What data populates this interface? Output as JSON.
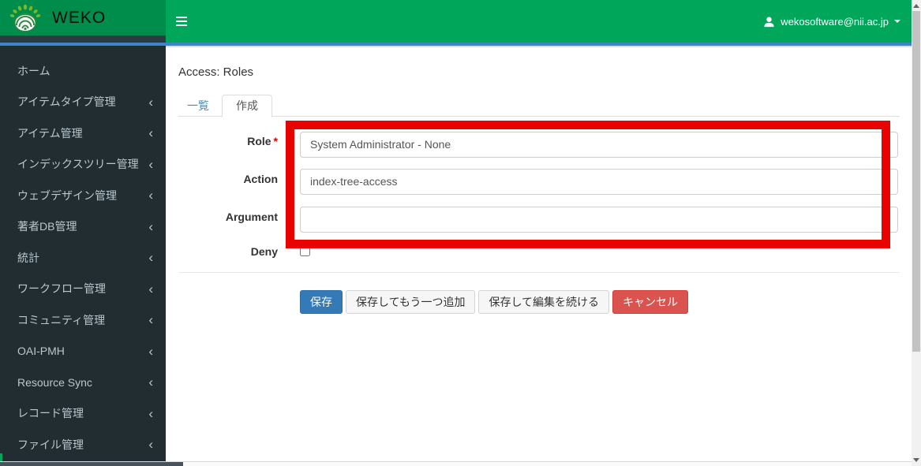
{
  "header": {
    "brand": "WEKO",
    "user_email": "wekosoftware@nii.ac.jp"
  },
  "sidebar": {
    "items": [
      {
        "label": "ホーム",
        "has_submenu": false
      },
      {
        "label": "アイテムタイプ管理",
        "has_submenu": true
      },
      {
        "label": "アイテム管理",
        "has_submenu": true
      },
      {
        "label": "インデックスツリー管理",
        "has_submenu": true
      },
      {
        "label": "ウェブデザイン管理",
        "has_submenu": true
      },
      {
        "label": "著者DB管理",
        "has_submenu": true
      },
      {
        "label": "統計",
        "has_submenu": true
      },
      {
        "label": "ワークフロー管理",
        "has_submenu": true
      },
      {
        "label": "コミュニティ管理",
        "has_submenu": true
      },
      {
        "label": "OAI-PMH",
        "has_submenu": true
      },
      {
        "label": "Resource Sync",
        "has_submenu": true
      },
      {
        "label": "レコード管理",
        "has_submenu": true
      },
      {
        "label": "ファイル管理",
        "has_submenu": true
      }
    ]
  },
  "main": {
    "title": "Access: Roles",
    "tabs": [
      {
        "label": "一覧",
        "active": false
      },
      {
        "label": "作成",
        "active": true
      }
    ],
    "form": {
      "required_marker": "*",
      "fields": [
        {
          "label": "Role",
          "required": true,
          "type": "select",
          "value": "System Administrator - None"
        },
        {
          "label": "Action",
          "required": false,
          "type": "select",
          "value": "index-tree-access"
        },
        {
          "label": "Argument",
          "required": false,
          "type": "text",
          "value": ""
        },
        {
          "label": "Deny",
          "required": false,
          "type": "checkbox",
          "checked": false
        }
      ],
      "buttons": [
        {
          "label": "保存",
          "style": "primary"
        },
        {
          "label": "保存してもう一つ追加",
          "style": "default"
        },
        {
          "label": "保存して編集を続ける",
          "style": "default"
        },
        {
          "label": "キャンセル",
          "style": "danger"
        }
      ]
    }
  },
  "annotation": {
    "shape": "rectangle",
    "color": "#e80200"
  },
  "colors": {
    "header_green": "#00a65a",
    "logo_green": "#008d4c",
    "sidebar_bg": "#222d32",
    "sidebar_text": "#b8c7ce",
    "accent_blue_line": "#3d85c6",
    "tab_link_blue": "#3c8dbc",
    "primary_button": "#337ab7",
    "danger_button": "#d9534f",
    "annotation_red": "#e80200"
  }
}
